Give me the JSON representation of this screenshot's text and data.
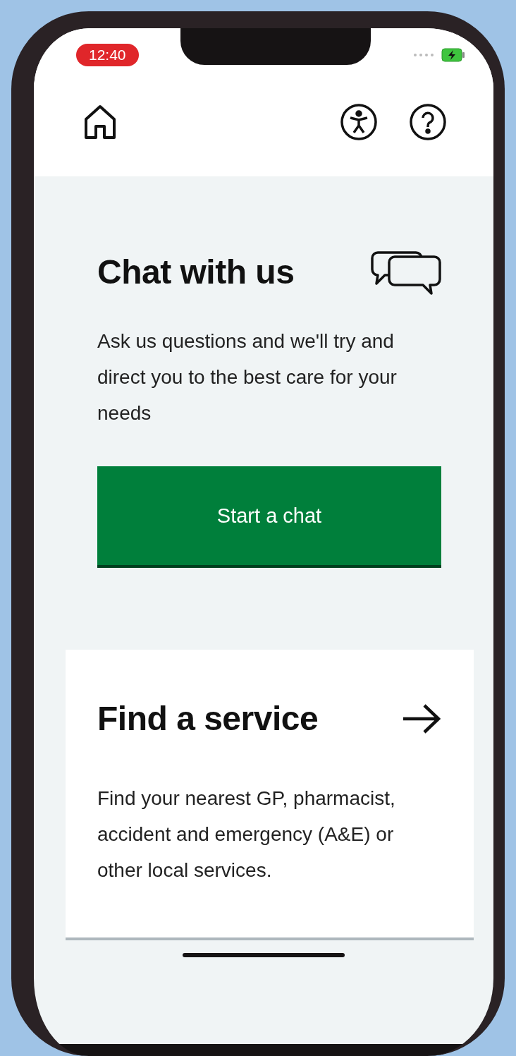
{
  "status_bar": {
    "time": "12:40"
  },
  "chat": {
    "title": "Chat with us",
    "description": "Ask us questions and we'll try and direct you to the best care for your needs",
    "button": "Start a chat"
  },
  "service": {
    "title": "Find a service",
    "description": "Find your nearest GP, pharmacist, accident and emergency (A&E) or other local services."
  }
}
